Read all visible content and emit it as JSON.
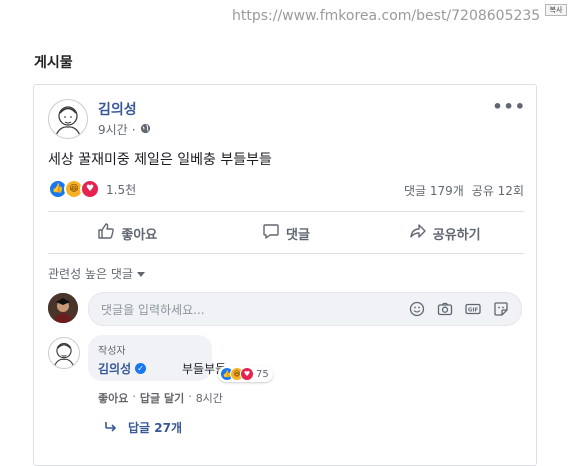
{
  "url": "https://www.fmkorea.com/best/7208605235",
  "copy_label": "복사",
  "section_title": "게시물",
  "post": {
    "author": "김의성",
    "time": "9시간",
    "text": "세상 꿀재미중 제일은 일베충 부들부들",
    "reaction_count": "1.5천",
    "comment_count": "댓글 179개",
    "share_count": "공유 12회"
  },
  "actions": {
    "like": "좋아요",
    "comment": "댓글",
    "share": "공유하기"
  },
  "sort_label": "관련성 높은 댓글",
  "comment_input": {
    "placeholder": "댓글을 입력하세요..."
  },
  "comment": {
    "role": "작성자",
    "author": "김의성",
    "text": "부들부들",
    "reaction_count": "75",
    "like": "좋아요",
    "reply": "답글 달기",
    "time": "8시간",
    "replies": "답글 27개"
  },
  "colors": {
    "link_blue": "#385898",
    "like_blue": "#1877f2",
    "haha_yellow": "#f7b125",
    "love_red": "#e4234e"
  }
}
